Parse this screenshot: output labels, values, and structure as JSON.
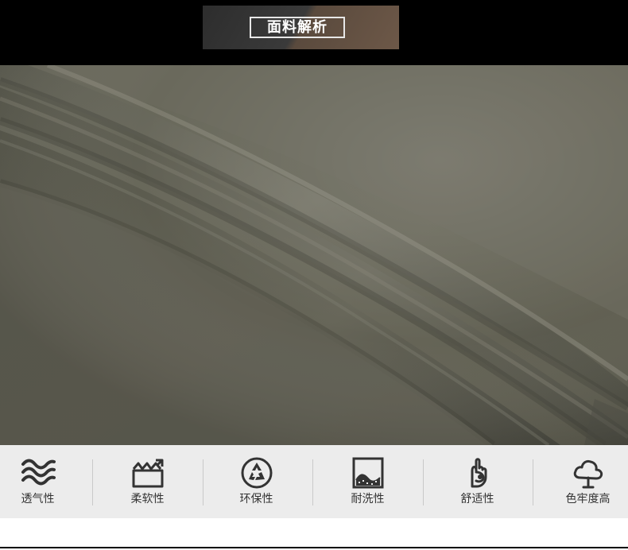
{
  "header": {
    "title": "面料解析"
  },
  "features": [
    {
      "label": "透气性",
      "icon": "waves-icon"
    },
    {
      "label": "柔软性",
      "icon": "soft-fabric-icon"
    },
    {
      "label": "环保性",
      "icon": "recycle-icon"
    },
    {
      "label": "耐洗性",
      "icon": "washable-fabric-icon"
    },
    {
      "label": "舒适性",
      "icon": "hand-ok-icon"
    },
    {
      "label": "色牢度高",
      "icon": "tree-icon"
    }
  ]
}
